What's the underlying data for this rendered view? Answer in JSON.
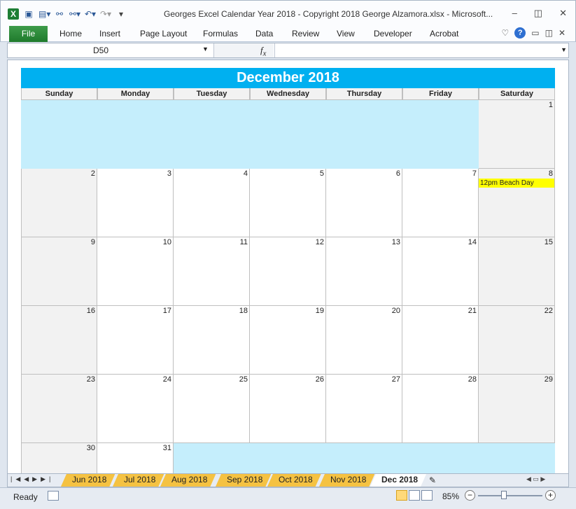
{
  "window": {
    "title": "Georges Excel Calendar Year 2018  -  Copyright 2018 George Alzamora.xlsx  -  Microsoft...",
    "minimize": "▭",
    "restore": "◫",
    "close": "✕"
  },
  "quick_access": {
    "excel_icon": "X",
    "save_icon": "floppy-disk-icon",
    "form_icon": "form-icon",
    "binoculars_icon": "binoculars-icon",
    "undo_icon": "undo-icon",
    "redo_icon": "redo-icon"
  },
  "ribbon": {
    "file": "File",
    "tabs": [
      "Home",
      "Insert",
      "Page Layout",
      "Formulas",
      "Data",
      "Review",
      "View",
      "Developer",
      "Acrobat"
    ],
    "help": "?"
  },
  "formula_bar": {
    "name_box": "D50",
    "fx": "fx",
    "value": ""
  },
  "calendar": {
    "month_title": "December 2018",
    "weekdays": [
      "Sunday",
      "Monday",
      "Tuesday",
      "Wednesday",
      "Thursday",
      "Friday",
      "Saturday"
    ],
    "weeks": [
      [
        "",
        "",
        "",
        "",
        "",
        "",
        "1"
      ],
      [
        "2",
        "3",
        "4",
        "5",
        "6",
        "7",
        "8"
      ],
      [
        "9",
        "10",
        "11",
        "12",
        "13",
        "14",
        "15"
      ],
      [
        "16",
        "17",
        "18",
        "19",
        "20",
        "21",
        "22"
      ],
      [
        "23",
        "24",
        "25",
        "26",
        "27",
        "28",
        "29"
      ],
      [
        "30",
        "31",
        "",
        "",
        "",
        "",
        ""
      ]
    ],
    "event": {
      "day": "8",
      "text": "12pm Beach Day",
      "color": "#ffff00"
    },
    "header_color": "#00b0f0",
    "blank_color": "#c5eefc"
  },
  "sheet_tabs": [
    "Jun 2018",
    "Jul 2018",
    "Aug 2018",
    "Sep 2018",
    "Oct 2018",
    "Nov 2018",
    "Dec 2018"
  ],
  "active_sheet": "Dec 2018",
  "status": {
    "ready": "Ready",
    "zoom": "85%",
    "zoom_out": "−",
    "zoom_in": "+"
  }
}
